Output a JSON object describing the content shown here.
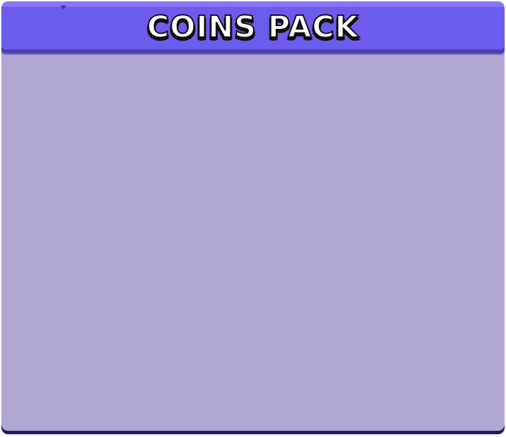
{
  "panel": {
    "title": "COINS PACK",
    "colors": {
      "header": "#6c5ced",
      "header_shadow": "#4b3fb2",
      "body": "#b2a7d3",
      "bottom_edge": "#231c5e",
      "title_text": "#ffffff",
      "title_outline": "#111111"
    }
  }
}
